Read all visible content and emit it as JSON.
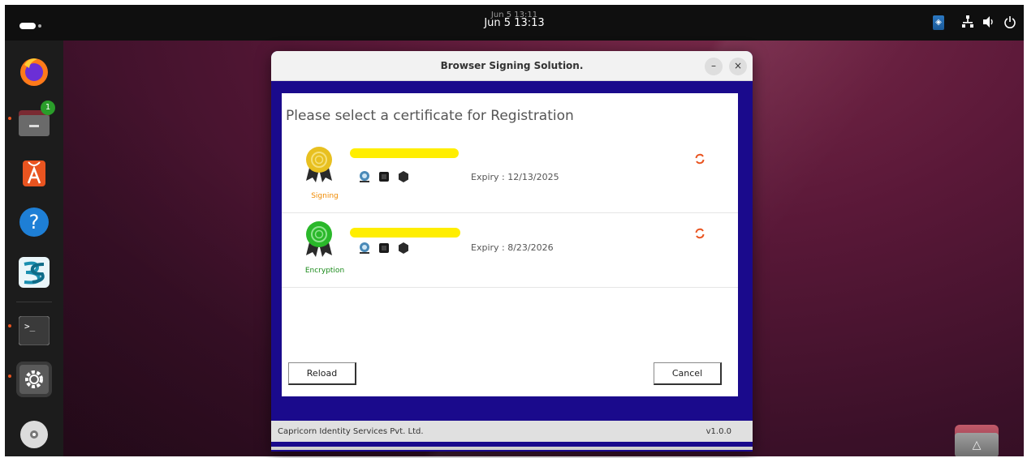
{
  "topbar": {
    "clock": "Jun 5  13:13",
    "clock_ghost": "Jun 5  13:11"
  },
  "dock": {
    "files_badge": "1",
    "items": [
      "firefox-icon",
      "files-icon",
      "app-center-icon",
      "help-icon",
      "bs-app-icon",
      "terminal-icon",
      "settings-icon",
      "disc-icon"
    ]
  },
  "dialog": {
    "title": "Browser Signing Solution.",
    "minimize_glyph": "–",
    "close_glyph": "×",
    "heading": "Please select a certificate for Registration",
    "certificates": [
      {
        "type": "Signing",
        "type_color": "#f08a00",
        "medal_color": "#e8c020",
        "expiry": "Expiry : 12/13/2025"
      },
      {
        "type": "Encryption",
        "type_color": "#1a8a1a",
        "medal_color": "#2ab82a",
        "expiry": "Expiry : 8/23/2026"
      }
    ],
    "reload_label": "Reload",
    "cancel_label": "Cancel",
    "footer_company": "Capricorn Identity Services Pvt. Ltd.",
    "footer_version": "v1.0.0"
  },
  "colors": {
    "accent_orange": "#e95420",
    "dialog_blue": "#1a0a8c",
    "redaction_yellow": "#ffee00"
  }
}
